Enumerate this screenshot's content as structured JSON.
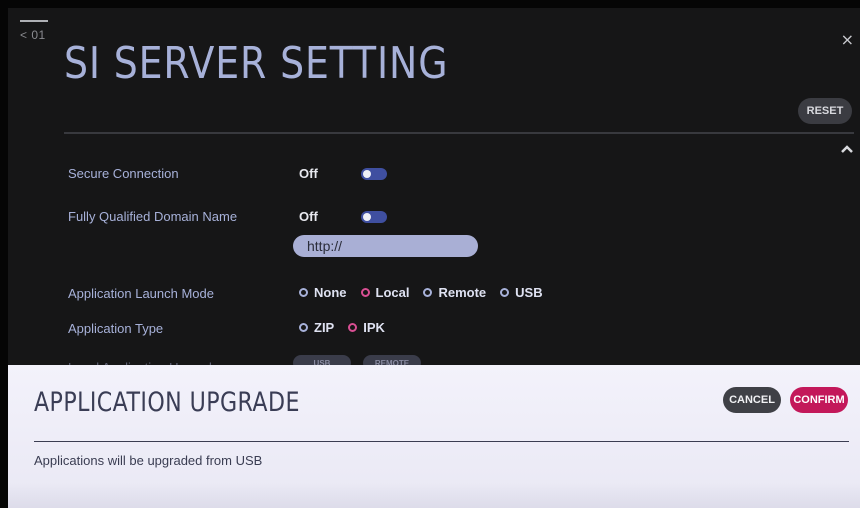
{
  "nav": {
    "back_label": "< 01",
    "close_glyph": "×"
  },
  "page": {
    "title": "SI SERVER SETTING",
    "reset_label": "RESET"
  },
  "settings": {
    "secure_connection": {
      "label": "Secure Connection",
      "value": "Off"
    },
    "fqdn": {
      "label": "Fully Qualified Domain Name",
      "value": "Off",
      "url_value": "http://"
    },
    "launch_mode": {
      "label": "Application Launch Mode",
      "options": [
        "None",
        "Local",
        "Remote",
        "USB"
      ],
      "selected": "Local"
    },
    "app_type": {
      "label": "Application Type",
      "options": [
        "ZIP",
        "IPK"
      ],
      "selected": "IPK"
    },
    "local_upgrade": {
      "label": "Local Application Upgrade",
      "usb_label": "USB",
      "remote_label": "REMOTE"
    }
  },
  "dialog": {
    "title": "APPLICATION UPGRADE",
    "cancel_label": "CANCEL",
    "confirm_label": "CONFIRM",
    "message": "Applications will be upgraded from USB"
  },
  "colors": {
    "accent_label": "#a7b1d9",
    "confirm": "#c3185a",
    "toggle_track": "#3f4fa0",
    "selected_radio": "#d94f93"
  }
}
